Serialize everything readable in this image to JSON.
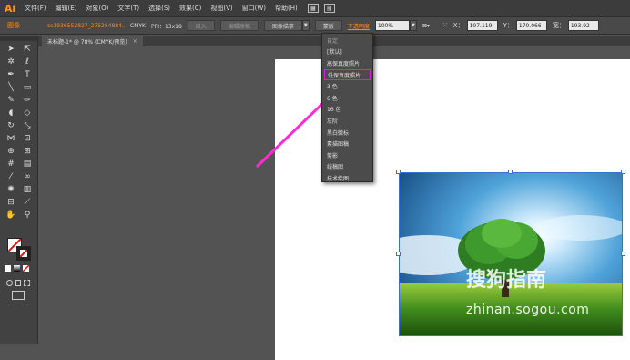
{
  "app": {
    "logo": "Ai"
  },
  "menubar": {
    "items": [
      "文件(F)",
      "编辑(E)",
      "对象(O)",
      "文字(T)",
      "选择(S)",
      "效果(C)",
      "视图(V)",
      "窗口(W)",
      "帮助(H)"
    ]
  },
  "control_bar": {
    "object_type": "图像",
    "file_link": "sc1936552827_275284884...",
    "color_mode": "CMYK",
    "ppi": "PPI：13x18",
    "embed_button": "嵌入",
    "edit_original_button": "编辑原稿",
    "image_trace_button": "图像描摹",
    "mask_button": "蒙版",
    "opacity_label": "不透明度",
    "opacity_value": "100%",
    "x_label": "X：",
    "x_value": "107.119",
    "y_label": "Y：",
    "y_value": "170.066",
    "w_label": "宽：",
    "w_value": "193.92"
  },
  "document_tab": {
    "title": "未标题-1* @ 78% (CMYK/预览)",
    "close": "×"
  },
  "trace_preset_menu": {
    "items": [
      "自定",
      "[默认]",
      "高保真度照片",
      "低保真度照片",
      "3 色",
      "6 色",
      "16 色",
      "灰阶",
      "黑白徽标",
      "素描图稿",
      "剪影",
      "线稿图",
      "技术绘图"
    ],
    "selected": "低保真度照片"
  },
  "watermark": {
    "brand": "搜狗指南",
    "url": "zhinan.sogou.com"
  },
  "colors": {
    "accent_orange": "#ff8a1a",
    "highlight_magenta": "#e020c8",
    "arrow": "#ff2bd6"
  }
}
